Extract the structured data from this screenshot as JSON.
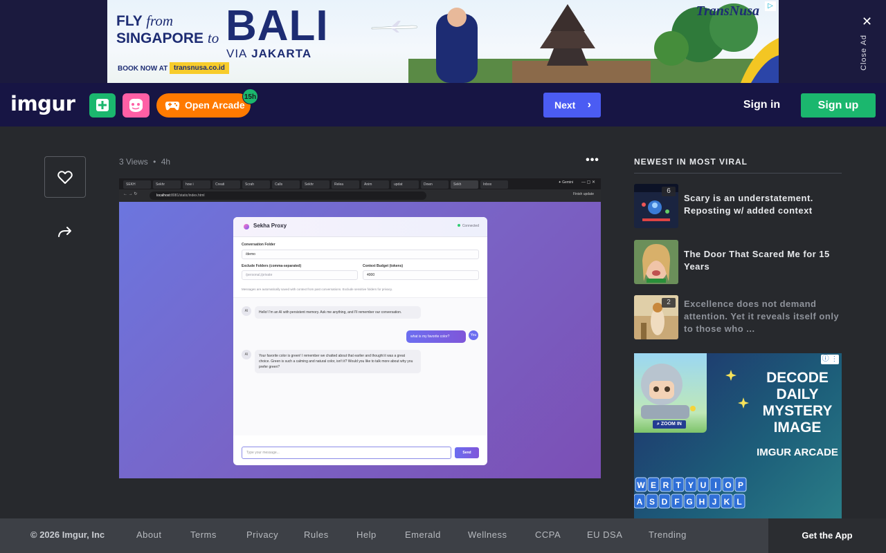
{
  "top_ad": {
    "fly_line1": "FLY",
    "from": "from",
    "singapore": "SINGAPORE",
    "to": "to",
    "destination": "BALI",
    "via_word": "VIA",
    "via_city": "JAKARTA",
    "book_now": "BOOK NOW AT",
    "url": "transnusa.co.id",
    "brand": "TransNusa",
    "close_label": "Close Ad"
  },
  "header": {
    "logo": "imgur",
    "upload_icon": "plus-square-icon",
    "meme_icon": "meme-face-icon",
    "arcade_label": "Open Arcade",
    "arcade_badge": "15h",
    "next_label": "Next",
    "signin_label": "Sign in",
    "signup_label": "Sign up",
    "colors": {
      "nav_bg": "#171544",
      "green": "#1bb76e",
      "pink": "#ff5fa5",
      "orange": "#ff7a00",
      "blue": "#4b5cf3"
    }
  },
  "post": {
    "views": "3 Views",
    "separator": "•",
    "age": "4h",
    "more_icon": "ellipsis-icon",
    "favorite_icon": "heart-icon",
    "share_icon": "share-arrow-icon",
    "image": {
      "tabs": [
        "SEKH",
        "Sekhr",
        "how i",
        "Creati",
        "Scrah",
        "Calls",
        "Sekhr",
        "Relea",
        "Anim",
        "updat",
        "Down",
        "Sekh",
        "Inbox"
      ],
      "gemini": "Gemini",
      "address": "localhost",
      "address_rest": ":8081/static/index.html",
      "finish_update": "Finish update",
      "app_title": "Sekha Proxy",
      "app_status": "Connected",
      "folder_label": "Conversation Folder",
      "folder_value": "/demo",
      "exclude_label": "Exclude Folders (comma-separated)",
      "exclude_placeholder": "/personal,/private",
      "budget_label": "Context Budget (tokens)",
      "budget_value": "4000",
      "note": "Messages are automatically saved with context from past conversations. Exclude sensitive folders for privacy.",
      "messages": [
        {
          "from": "AI",
          "text": "Hello! I'm an AI with persistent memory. Ask me anything, and I'll remember our conversation."
        },
        {
          "from": "You",
          "text": "what is my favorite color?"
        },
        {
          "from": "AI",
          "text": "Your favorite color is green! I remember we chatted about that earlier and thought it was a great choice. Green is such a calming and natural color, isn't it? Would you like to talk more about why you prefer green?"
        }
      ],
      "input_placeholder": "Type your message...",
      "send_label": "Send"
    }
  },
  "sidebar": {
    "title": "NEWEST IN MOST VIRAL",
    "items": [
      {
        "title": "Scary is an understatement. Reposting w/ added context",
        "count": "6"
      },
      {
        "title": "The Door That Scared Me for 15 Years",
        "count": ""
      },
      {
        "title": "Excellence does not demand attention. Yet it reveals itself only to those who ...",
        "count": "2"
      }
    ],
    "ad": {
      "headline": "DECODE DAILY MYSTERY IMAGE",
      "sub": "IMGUR ARCADE",
      "zoom": "ZOOM IN",
      "keys_row1": "WERTYUIOP",
      "keys_row2": "ASDFGHJKL"
    }
  },
  "footer": {
    "copyright": "© 2026 Imgur, Inc",
    "links": [
      "About",
      "Terms",
      "Privacy",
      "Rules",
      "Help",
      "Emerald",
      "Wellness",
      "CCPA",
      "EU DSA",
      "Trending"
    ],
    "get_app": "Get the App"
  }
}
